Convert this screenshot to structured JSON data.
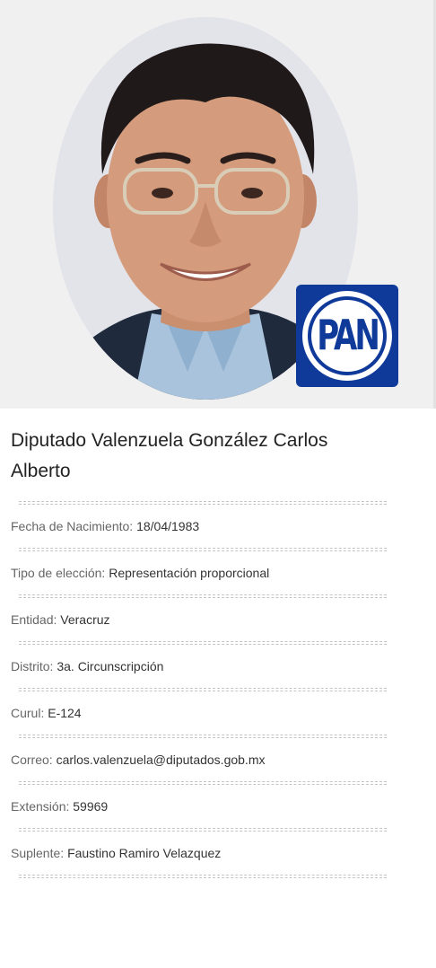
{
  "profile": {
    "name": "Diputado Valenzuela González Carlos Alberto",
    "party_logo_text": "PAN",
    "fields": [
      {
        "label": "Fecha de Nacimiento: ",
        "value": "18/04/1983"
      },
      {
        "label": "Tipo de elección: ",
        "value": "Representación proporcional"
      },
      {
        "label": "Entidad: ",
        "value": "Veracruz"
      },
      {
        "label": "Distrito: ",
        "value": "3a. Circunscripción"
      },
      {
        "label": "Curul: ",
        "value": "E-124"
      },
      {
        "label": "Correo: ",
        "value": "carlos.valenzuela@diputados.gob.mx"
      },
      {
        "label": "Extensión: ",
        "value": "59969"
      },
      {
        "label": "Suplente: ",
        "value": "Faustino Ramiro Velazquez"
      }
    ]
  },
  "colors": {
    "header_bg": "#f0f0f0",
    "party_blue": "#0f3a9a",
    "separator": "#c4c4c4"
  },
  "icons": {
    "portrait": "deputy-portrait-photo",
    "party_logo": "pan-party-logo"
  }
}
